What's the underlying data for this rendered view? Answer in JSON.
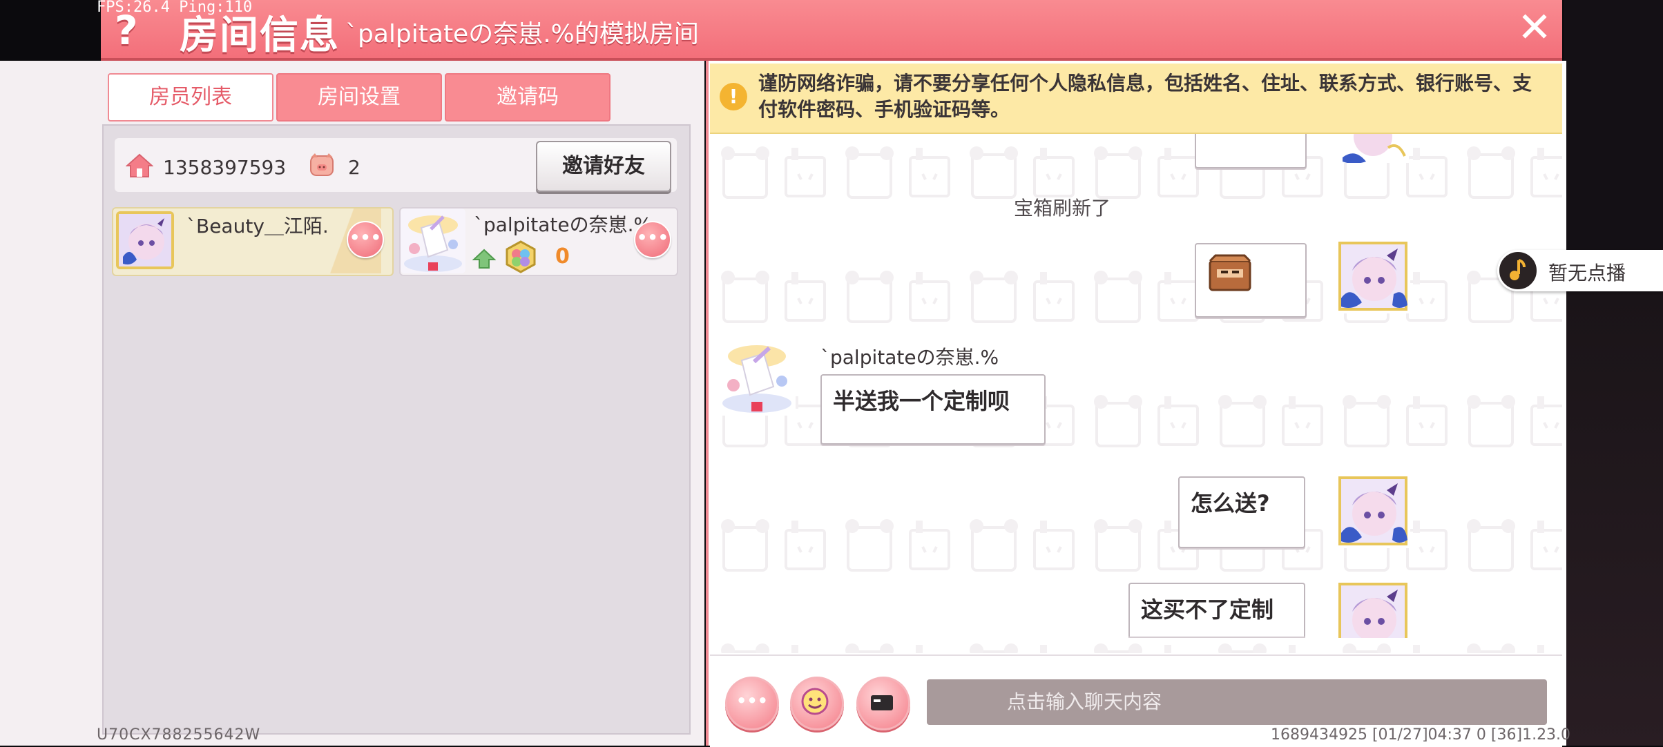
{
  "debug": {
    "fps_text": "FPS:26.4  Ping:110"
  },
  "header": {
    "help_glyph": "?",
    "title": "房间信息",
    "subtitle": "`palpitateの奈崽.%的模拟房间",
    "close_glyph": "✕"
  },
  "tabs": [
    {
      "label": "房员列表",
      "active": true
    },
    {
      "label": "房间设置",
      "active": false
    },
    {
      "label": "邀请码",
      "active": false
    }
  ],
  "room": {
    "id": "1358397593",
    "member_count": "2",
    "invite_button": "邀请好友"
  },
  "members": [
    {
      "name": "`Beauty＿江陌.",
      "more": "•••"
    },
    {
      "name": "`palpitateの奈崽.%",
      "more": "•••",
      "gem_count": "0"
    }
  ],
  "footer": {
    "uid": "U70CX788255642W",
    "status": "1689434925    [01/27]04:37 0    [36]1.23.0"
  },
  "notice": {
    "icon": "!",
    "text": "谨防网络诈骗，请不要分享任何个人隐私信息，包括姓名、住址、联系方式、银行账号、支付软件密码、手机验证码等。"
  },
  "chat": {
    "system_message": "宝箱刷新了",
    "sender_name": "`palpitateの奈崽.%",
    "messages": [
      {
        "text": "半送我一个定制呗"
      },
      {
        "text": "怎么送?"
      },
      {
        "text": "这买不了定制"
      }
    ],
    "input_placeholder": "点击输入聊天内容",
    "more_glyph": "•••"
  },
  "music": {
    "label": "暂无点播"
  },
  "colors": {
    "accent": "#f36f7a",
    "tab_active_text": "#e55b68",
    "notice_bg": "#fde9a6",
    "gem_count": "#f08a2a"
  },
  "icons": [
    "help-icon",
    "close-icon",
    "home-icon",
    "pig-icon",
    "more-icon",
    "level-up-icon",
    "gem-icon",
    "warning-icon",
    "emoji-icon",
    "card-icon",
    "music-note-icon",
    "treasure-chest-icon"
  ]
}
